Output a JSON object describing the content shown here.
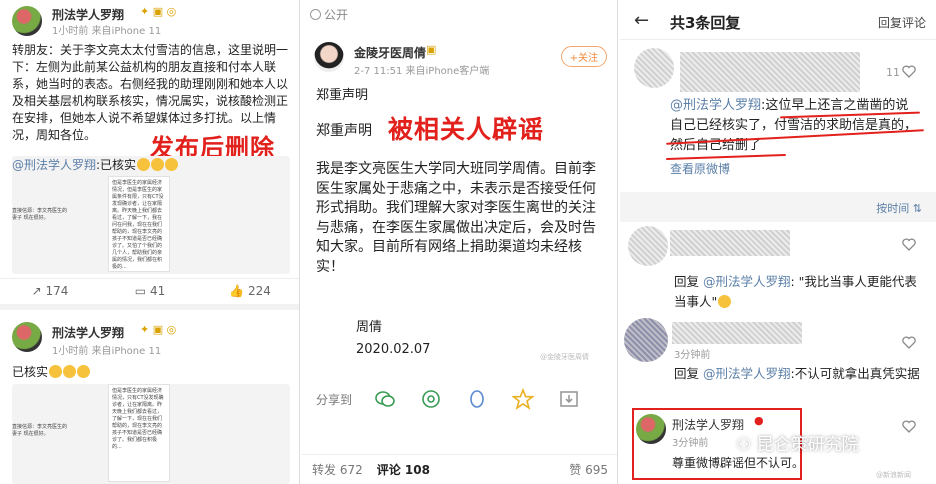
{
  "panel1": {
    "post1": {
      "author": "刑法学人罗翔",
      "meta": "1小时前 来自iPhone 11",
      "text": "转朋友：关于李文亮太太付雪洁的信息，这里说明一下：左侧为此前某公益机构的朋友直接和付本人联系，她当时的表态。右侧经我的助理刚刚和她本人以及相关基层机构联系核实，情况属实，说核酸检测正在安排，但她本人说不希望媒体过多打扰。以上情况，周知各位。",
      "annotation": "发布后删除",
      "quote_author": "@刑法学人罗翔",
      "quote_text": ":已核实",
      "thumb_left": "直接信源：李文亮医生的妻子 现在很好。",
      "thumb_right": "但是李医生的家属经济情况，但是李医生的家属条件有限，只有CT没发现确诊者，让在家隔离。昨天晚上我们都去看过，了解一下，我在问在问我，现在在我们帮助的，现在李文亮的孩子不知道是否已经确诊了。又怕了个我们的几个人，帮助我们的亲属的情况，我们都在积极的...",
      "repost_count": "174",
      "comment_count": "41",
      "like_count": "224"
    },
    "post2": {
      "author": "刑法学人罗翔",
      "meta": "1小时前 来自iPhone 11",
      "text": "已核实",
      "thumb_left": "直接信源：李文亮医生的妻子 现在很好。",
      "thumb_right": "但是李医生的家属经济情况，只有CT没发现确诊者，让在家隔离。昨天晚上我们都去看过，了解一下，现在在我们帮助的，现在李文亮的孩子不知道是否已经确诊了。我们都在积极的..."
    }
  },
  "panel2": {
    "visibility": "公开",
    "author": "金陵牙医周倩",
    "meta": "2-7 11:51 来自iPhone客户端",
    "follow_label": "+关注",
    "heading": "郑重声明",
    "title_prefix": "郑重声明",
    "annotation": "被相关人辟谣",
    "body": "我是李文亮医生大学同大班同学周倩。目前李医生家属处于悲痛之中，未表示是否接受任何形式捐助。我们理解大家对李医生离世的关注与悲痛，在李医生家属做出决定后，会及时告知大家。目前所有网络上捐助渠道均未经核实！",
    "signature": "周倩",
    "date": "2020.02.07",
    "watermark": "@金陵牙医周倩",
    "share_label": "分享到",
    "repost_tab": "转发 672",
    "comment_tab": "评论 108",
    "like_tab": "赞 695"
  },
  "panel3": {
    "title": "共3条回复",
    "reply_comment": "回复评论",
    "first_like_count": "11",
    "first_reply_mention": "@刑法学人罗翔",
    "first_reply_text": ":这位早上还言之凿凿的说自己已经核实了，付雪洁的求助信是真的，然后自己给删了",
    "view_original": "查看原微博",
    "sort_label": "按时间",
    "reply2_prefix": "回复 ",
    "reply2_mention": "@刑法学人罗翔",
    "reply2_text": ": \"我比当事人更能代表当事人\"",
    "reply3_time": "3分钟前",
    "reply3_prefix": "回复 ",
    "reply3_mention": "@刑法学人罗翔",
    "reply3_text": ":不认可就拿出真凭实据",
    "boxed_author": "刑法学人罗翔",
    "boxed_time": "3分钟前",
    "boxed_text": "尊重微博辟谣但不认可。",
    "wechat_watermark": "昆仑策研究院",
    "weibo_watermark": "@新浪新闻"
  },
  "colors": {
    "annotation_red": "#e2201c",
    "link_blue": "#5b7fa8",
    "follow_orange": "#f08a3c"
  }
}
